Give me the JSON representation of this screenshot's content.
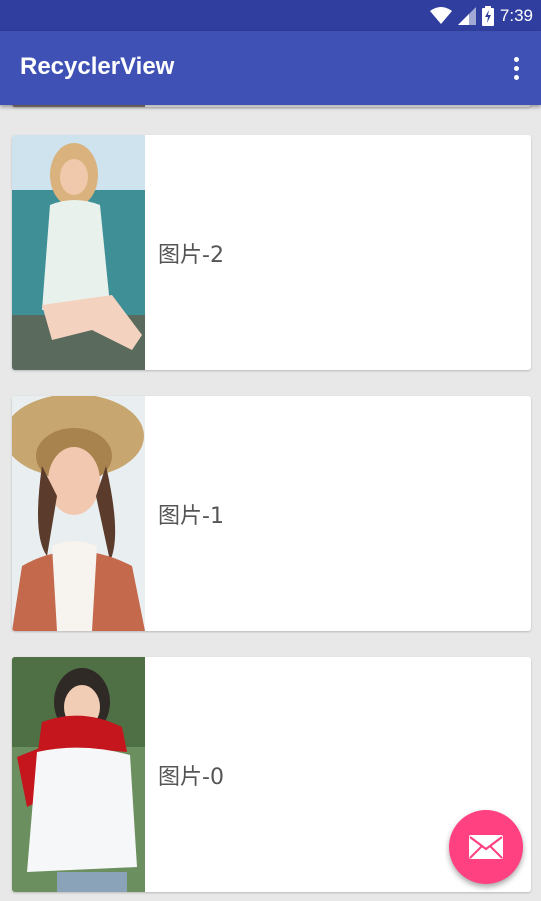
{
  "status_bar": {
    "time": "7:39"
  },
  "app_bar": {
    "title": "RecyclerView"
  },
  "list": {
    "items": [
      {
        "label": "图片-2"
      },
      {
        "label": "图片-1"
      },
      {
        "label": "图片-0"
      }
    ]
  },
  "colors": {
    "primary": "#3f51b5",
    "primary_dark": "#303f9f",
    "accent": "#ff4081",
    "background": "#e8e8e8"
  },
  "fab": {
    "icon": "mail-icon"
  }
}
